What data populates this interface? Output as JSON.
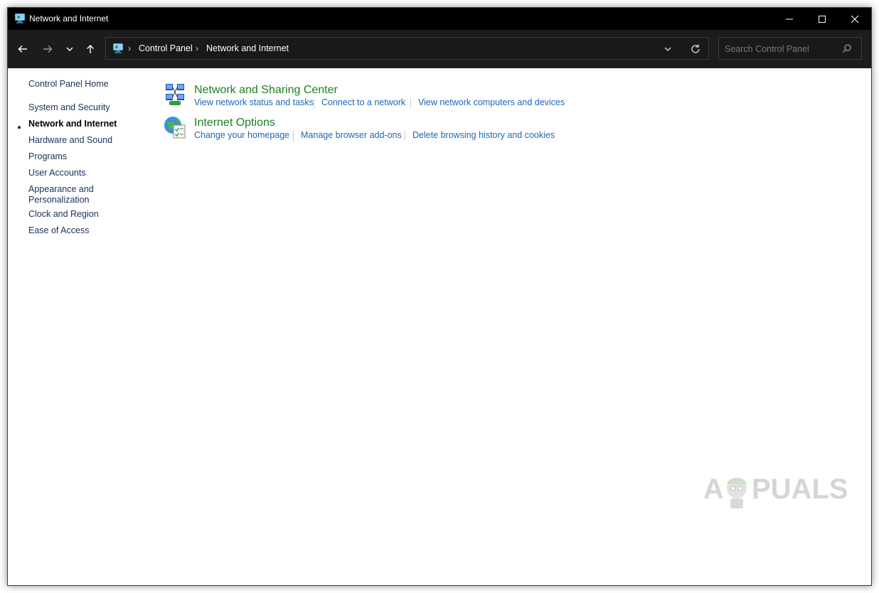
{
  "window": {
    "title": "Network and Internet"
  },
  "address_bar": {
    "breadcrumbs": [
      "Control Panel",
      "Network and Internet"
    ]
  },
  "search": {
    "placeholder": "Search Control Panel"
  },
  "sidebar": {
    "home": "Control Panel Home",
    "items": [
      {
        "label": "System and Security",
        "active": false
      },
      {
        "label": "Network and Internet",
        "active": true
      },
      {
        "label": "Hardware and Sound",
        "active": false
      },
      {
        "label": "Programs",
        "active": false
      },
      {
        "label": "User Accounts",
        "active": false
      },
      {
        "label": "Appearance and Personalization",
        "active": false
      },
      {
        "label": "Clock and Region",
        "active": false
      },
      {
        "label": "Ease of Access",
        "active": false
      }
    ]
  },
  "categories": [
    {
      "title": "Network and Sharing Center",
      "icon": "network-sharing-icon",
      "tasks": [
        "View network status and tasks",
        "Connect to a network",
        "View network computers and devices"
      ]
    },
    {
      "title": "Internet Options",
      "icon": "internet-options-icon",
      "tasks": [
        "Change your homepage",
        "Manage browser add-ons",
        "Delete browsing history and cookies"
      ]
    }
  ],
  "watermark": {
    "text": "APPUALS"
  },
  "colors": {
    "titlebar": "#000000",
    "navbar": "#1c1c1c",
    "category_title": "#1e7d22",
    "task_link": "#1d66b8",
    "sidebar_link": "#1a2f5a"
  }
}
